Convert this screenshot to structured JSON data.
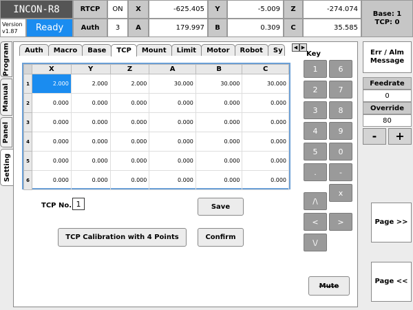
{
  "header": {
    "app_title": "INCON-R8",
    "version_label": "Version",
    "version_value": "v1.87",
    "status": "Ready",
    "rtcp_label": "RTCP",
    "rtcp_value": "ON",
    "auth_label": "Auth",
    "auth_value": "3",
    "axes": [
      {
        "label": "X",
        "value": "-625.405"
      },
      {
        "label": "Y",
        "value": "-5.009"
      },
      {
        "label": "Z",
        "value": "-274.074"
      },
      {
        "label": "A",
        "value": "179.997"
      },
      {
        "label": "B",
        "value": "0.309"
      },
      {
        "label": "C",
        "value": "35.585"
      }
    ],
    "base_line": "Base: 1",
    "tcp_line": "TCP: 0"
  },
  "right_panel": {
    "err_alm": "Err / Alm Message",
    "feedrate_label": "Feedrate",
    "feedrate_value": "0",
    "override_label": "Override",
    "override_value": "80",
    "minus": "-",
    "plus": "+",
    "page_next": "Page >>",
    "page_prev": "Page <<"
  },
  "side_tabs": [
    "Program",
    "Manual",
    "Panel",
    "Setting"
  ],
  "tabs": [
    "Auth",
    "Macro",
    "Base",
    "TCP",
    "Mount",
    "Limit",
    "Motor",
    "Robot",
    "Sy"
  ],
  "active_tab": "TCP",
  "table": {
    "columns": [
      "X",
      "Y",
      "Z",
      "A",
      "B",
      "C"
    ],
    "rows": [
      {
        "n": "1",
        "cells": [
          "2.000",
          "2.000",
          "2.000",
          "30.000",
          "30.000",
          "30.000"
        ]
      },
      {
        "n": "2",
        "cells": [
          "0.000",
          "0.000",
          "0.000",
          "0.000",
          "0.000",
          "0.000"
        ]
      },
      {
        "n": "3",
        "cells": [
          "0.000",
          "0.000",
          "0.000",
          "0.000",
          "0.000",
          "0.000"
        ]
      },
      {
        "n": "4",
        "cells": [
          "0.000",
          "0.000",
          "0.000",
          "0.000",
          "0.000",
          "0.000"
        ]
      },
      {
        "n": "5",
        "cells": [
          "0.000",
          "0.000",
          "0.000",
          "0.000",
          "0.000",
          "0.000"
        ]
      },
      {
        "n": "6",
        "cells": [
          "0.000",
          "0.000",
          "0.000",
          "0.000",
          "0.000",
          "0.000"
        ]
      }
    ]
  },
  "form": {
    "tcp_no_label": "TCP No.",
    "tcp_no_value": "1",
    "save": "Save",
    "calibration": "TCP Calibration with 4 Points",
    "confirm": "Confirm"
  },
  "keypad": {
    "title": "Key",
    "keys": [
      "1",
      "6",
      "2",
      "7",
      "3",
      "8",
      "4",
      "9",
      "5",
      "0",
      ".",
      "-",
      "x",
      "/\\",
      "<",
      ">",
      "\\/"
    ],
    "mute": "Mute"
  },
  "colors": {
    "accent": "#1a8cf0",
    "key": "#9a9a9a"
  }
}
